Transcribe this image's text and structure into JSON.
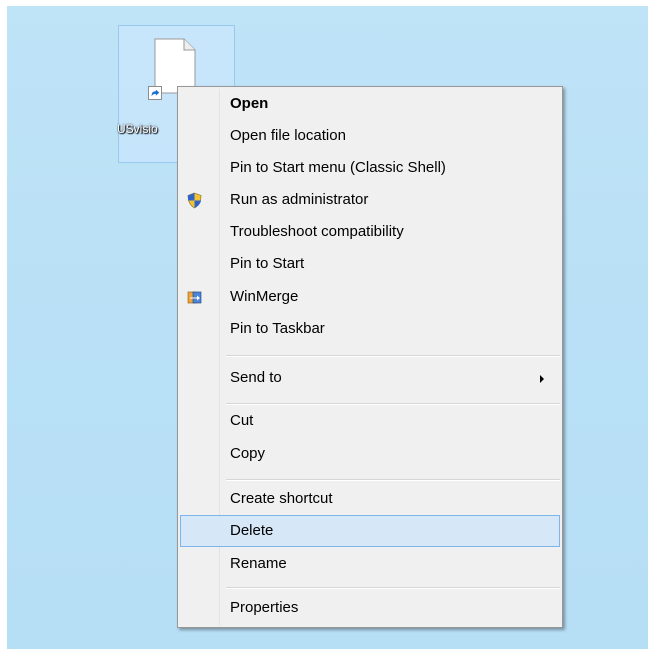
{
  "desktop_icon": {
    "label": "USvisio",
    "icon": "file-shortcut-icon",
    "selection_color": "#cde8ff"
  },
  "context_menu": {
    "items": [
      {
        "label": "Open",
        "bold": true,
        "icon": null
      },
      {
        "label": "Open file location",
        "icon": null
      },
      {
        "label": "Pin to Start menu (Classic Shell)",
        "icon": null
      },
      {
        "label": "Run as administrator",
        "icon": "uac-shield-icon"
      },
      {
        "label": "Troubleshoot compatibility",
        "icon": null
      },
      {
        "label": "Pin to Start",
        "icon": null
      },
      {
        "label": "WinMerge",
        "icon": "winmerge-icon"
      },
      {
        "label": "Pin to Taskbar",
        "icon": null
      },
      {
        "label": "Send to",
        "icon": null,
        "submenu": true
      },
      {
        "label": "Cut",
        "icon": null
      },
      {
        "label": "Copy",
        "icon": null
      },
      {
        "label": "Create shortcut",
        "icon": null
      },
      {
        "label": "Delete",
        "icon": null,
        "highlighted": true
      },
      {
        "label": "Rename",
        "icon": null
      },
      {
        "label": "Properties",
        "icon": null
      }
    ],
    "highlight_color": "#d6e7f8",
    "highlight_border": "#7eb4ea"
  }
}
